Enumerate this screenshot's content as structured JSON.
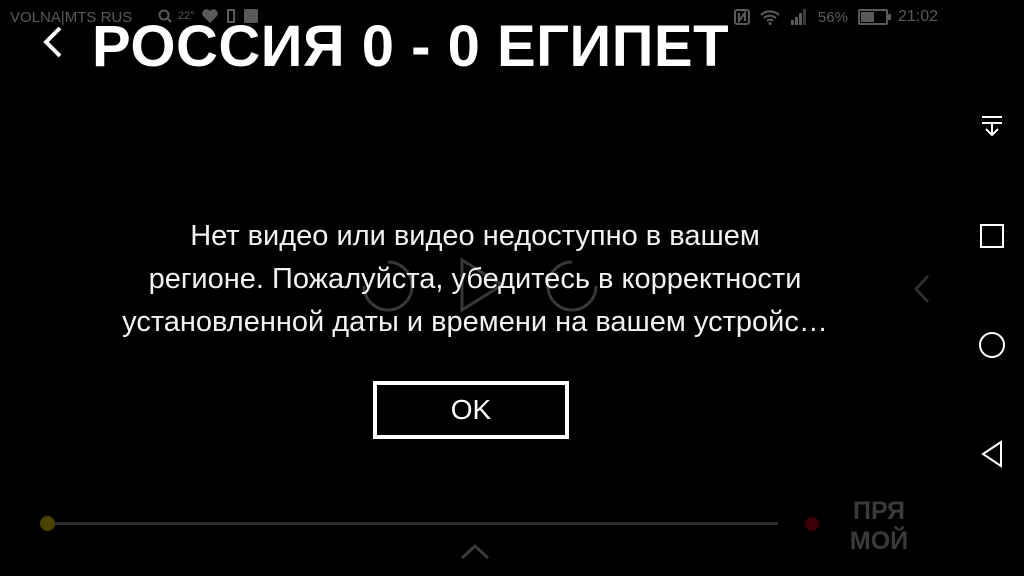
{
  "status_bar": {
    "carrier": "VOLNA|MTS RUS",
    "temperature": "22°",
    "battery_percent": "56%",
    "time": "21:02"
  },
  "header": {
    "title": "РОССИЯ 0 - 0 ЕГИПЕТ"
  },
  "dialog": {
    "message_line1": "Нет видео или видео недоступно в вашем",
    "message_line2": "регионе. Пожалуйста, убедитесь в корректности",
    "message_line3": "установленной даты и времени на вашем устройс…",
    "ok_label": "OK"
  },
  "player": {
    "live_label_line1": "ПРЯ",
    "live_label_line2": "МОЙ",
    "colors": {
      "seek_thumb": "#4b4300",
      "live_dot": "#3c0008"
    }
  },
  "navigation_bar": {
    "icons": [
      "notification-pull-icon",
      "recents-square-icon",
      "home-circle-icon",
      "back-triangle-icon"
    ]
  }
}
